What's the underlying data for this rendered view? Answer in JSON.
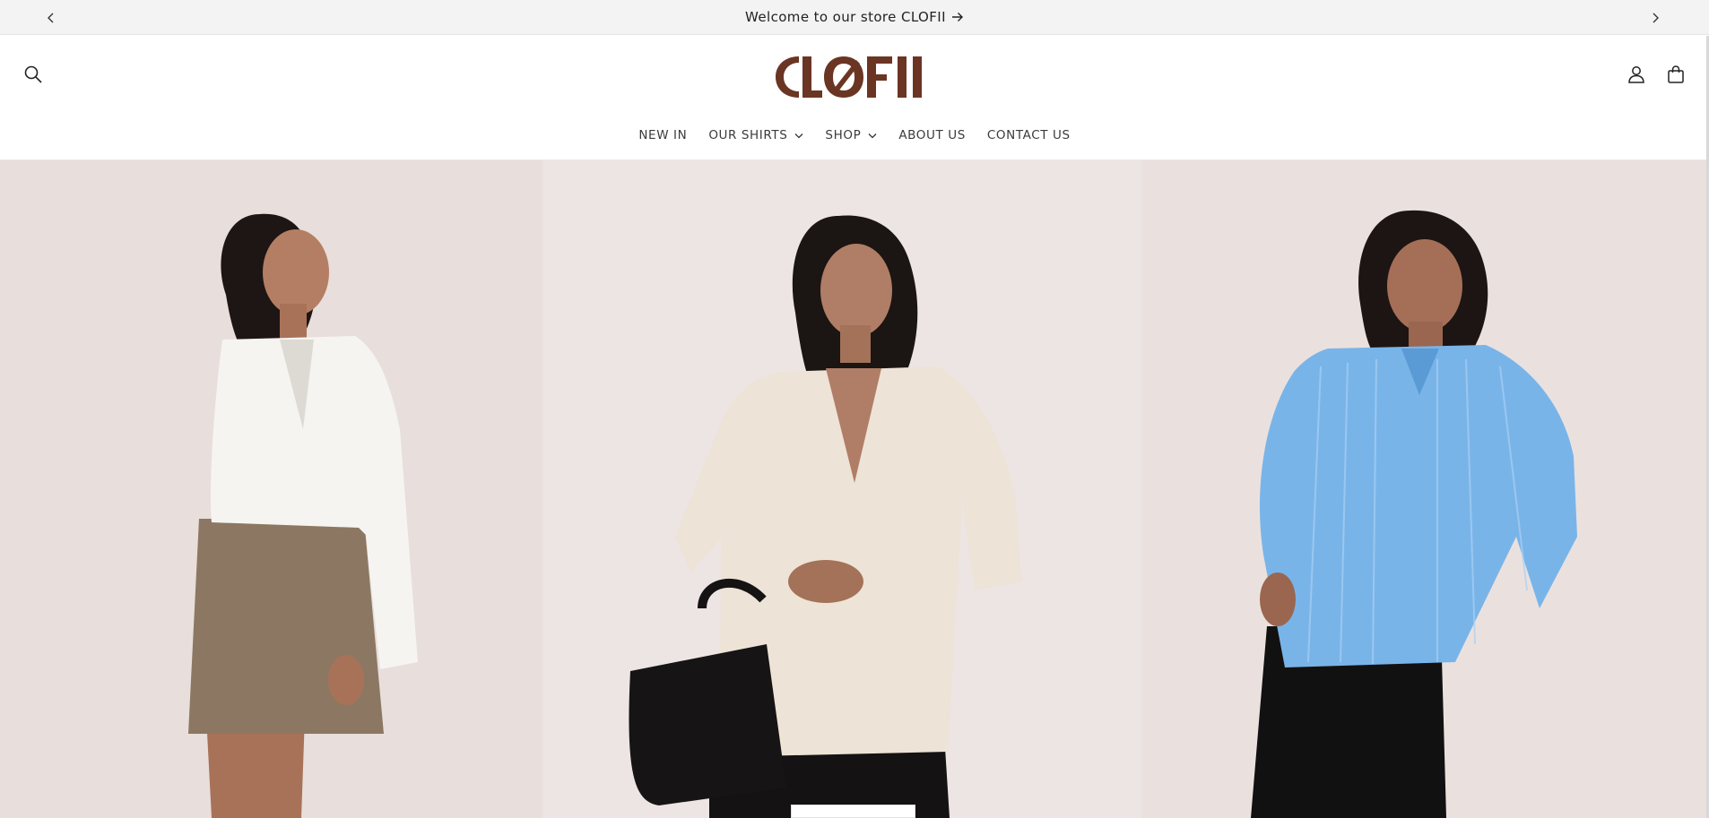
{
  "announcement": {
    "text": "Welcome to our store CLOFII",
    "prev_icon": "chevron-left-icon",
    "next_icon": "chevron-right-icon",
    "arrow_icon": "arrow-right-icon"
  },
  "header": {
    "brand": "CLOFII",
    "brand_color": "#6b3523",
    "icons": {
      "search": "search-icon",
      "account": "account-icon",
      "cart": "cart-icon"
    }
  },
  "nav": {
    "items": [
      {
        "label": "NEW IN",
        "dropdown": false
      },
      {
        "label": "OUR SHIRTS",
        "dropdown": true
      },
      {
        "label": "SHOP",
        "dropdown": true
      },
      {
        "label": "ABOUT US",
        "dropdown": false
      },
      {
        "label": "CONTACT US",
        "dropdown": false
      }
    ]
  },
  "hero": {
    "panels": [
      {
        "shirt": "white cropped shirt",
        "shirt_color": "#f6f5f2"
      },
      {
        "shirt": "satin cream shirt",
        "shirt_color": "#ece1d3"
      },
      {
        "shirt": "blue striped shirt",
        "shirt_color": "#78b4ea"
      }
    ]
  }
}
